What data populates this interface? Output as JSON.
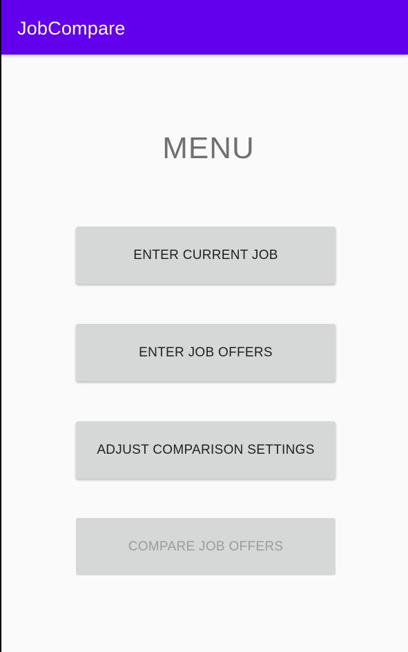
{
  "app_bar": {
    "title": "JobCompare",
    "color": "#6200ee"
  },
  "main": {
    "heading": "MENU",
    "buttons": [
      {
        "label": "ENTER CURRENT JOB",
        "enabled": true
      },
      {
        "label": "ENTER JOB OFFERS",
        "enabled": true
      },
      {
        "label": "ADJUST COMPARISON SETTINGS",
        "enabled": true
      },
      {
        "label": "COMPARE JOB OFFERS",
        "enabled": false
      }
    ]
  }
}
